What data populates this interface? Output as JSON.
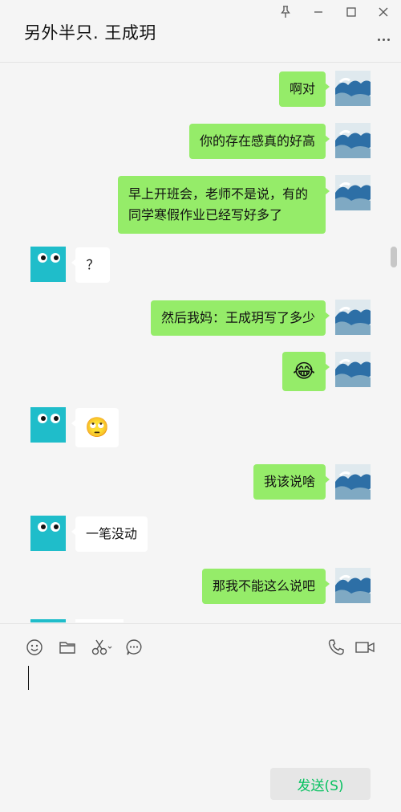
{
  "window": {
    "title": "另外半只. 王成玥",
    "pin_icon": "pin-icon",
    "minimize_icon": "minimize-icon",
    "maximize_icon": "maximize-icon",
    "close_icon": "close-icon",
    "more_icon": "more-options-icon"
  },
  "messages": [
    {
      "sender": "self",
      "text": "啊对"
    },
    {
      "sender": "self",
      "text": "你的存在感真的好高"
    },
    {
      "sender": "self",
      "text": "早上开班会，老师不是说，有的同学寒假作业已经写好多了"
    },
    {
      "sender": "other",
      "text": "？"
    },
    {
      "sender": "self",
      "text": "然后我妈：王成玥写了多少"
    },
    {
      "sender": "self",
      "text": "😂"
    },
    {
      "sender": "other",
      "text": "🙄"
    },
    {
      "sender": "self",
      "text": "我该说啥"
    },
    {
      "sender": "other",
      "text": "一笔没动"
    },
    {
      "sender": "self",
      "text": "那我不能这么说吧"
    }
  ],
  "toolbar": {
    "emoji_icon": "emoji-icon",
    "file_icon": "folder-icon",
    "screenshot_icon": "scissors-icon",
    "chat_history_icon": "chat-bubble-icon",
    "voice_call_icon": "phone-icon",
    "video_call_icon": "video-camera-icon"
  },
  "input": {
    "value": ""
  },
  "send_button": {
    "label": "发送(S)",
    "color": "#07c160"
  },
  "colors": {
    "self_bubble": "#95ec69",
    "other_bubble": "#ffffff",
    "other_avatar": "#1fbdca",
    "background": "#f5f5f5"
  }
}
